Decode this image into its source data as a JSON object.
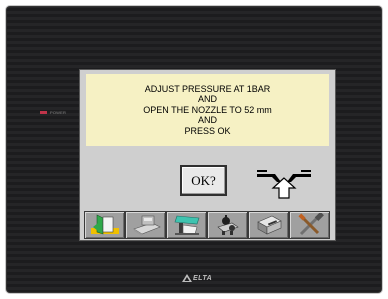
{
  "device": {
    "power_label": "POWER",
    "brand": "ELTA"
  },
  "message": {
    "lines": [
      "ADJUST PRESSURE AT 1BAR",
      "AND",
      "OPEN THE NOZZLE TO 52 mm",
      "AND",
      "PRESS OK"
    ]
  },
  "ok_button": {
    "label": "OK?"
  },
  "toolbar": {
    "tools": [
      {
        "icon": "exit-door-icon"
      },
      {
        "icon": "press-machine-icon"
      },
      {
        "icon": "nozzle-setup-icon"
      },
      {
        "icon": "mechanism-icon"
      },
      {
        "icon": "cutter-icon"
      },
      {
        "icon": "maintenance-tools-icon"
      }
    ]
  },
  "colors": {
    "message_bg": "#f6f1c4",
    "screen_bg": "#cfcfcf",
    "bezel": "#1e1e20",
    "power_led": "#c0344a"
  }
}
